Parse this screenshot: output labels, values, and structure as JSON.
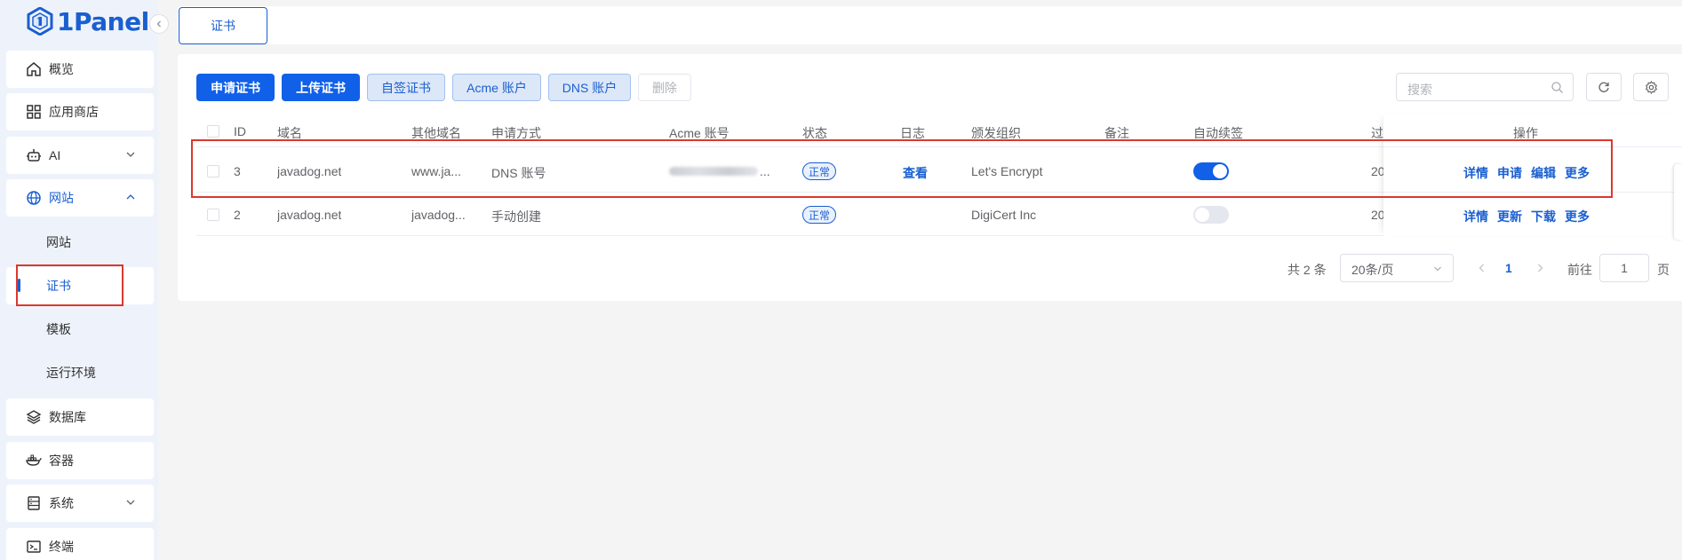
{
  "app": {
    "brand": "1Panel",
    "accent": "#1a5fd0",
    "highlight": "#d9392c"
  },
  "sidebar": {
    "items": [
      {
        "label": "概览",
        "icon": "home-icon"
      },
      {
        "label": "应用商店",
        "icon": "grid-icon"
      },
      {
        "label": "AI",
        "icon": "robot-icon"
      },
      {
        "label": "网站",
        "icon": "globe-icon"
      },
      {
        "label": "数据库",
        "icon": "layers-icon"
      },
      {
        "label": "容器",
        "icon": "docker-icon"
      },
      {
        "label": "系统",
        "icon": "server-icon"
      },
      {
        "label": "终端",
        "icon": "terminal-icon"
      }
    ],
    "website_subitems": [
      "网站",
      "证书",
      "模板",
      "运行环境"
    ],
    "active_subitem": "证书"
  },
  "header": {
    "tab": "证书"
  },
  "toolbar": {
    "apply_cert": "申请证书",
    "upload_cert": "上传证书",
    "self_signed": "自签证书",
    "acme_account": "Acme 账户",
    "dns_account": "DNS 账户",
    "delete": "删除",
    "search_placeholder": "搜索"
  },
  "table": {
    "columns": [
      "ID",
      "域名",
      "其他域名",
      "申请方式",
      "Acme 账号",
      "状态",
      "日志",
      "颁发组织",
      "备注",
      "自动续签",
      "过",
      "操作"
    ],
    "rows": [
      {
        "id": "3",
        "domain": "javadog.net",
        "other_domains": "www.ja...",
        "method": "DNS 账号",
        "acme_account": "(blurred)",
        "acme_suffix": "...",
        "status": "正常",
        "log": "查看",
        "issuer": "Let's Encrypt",
        "note": "",
        "auto_renew": true,
        "expire": "20",
        "actions": [
          "详情",
          "申请",
          "编辑",
          "更多"
        ]
      },
      {
        "id": "2",
        "domain": "javadog.net",
        "other_domains": "javadog...",
        "method": "手动创建",
        "acme_account": "",
        "status": "正常",
        "log": "",
        "issuer": "DigiCert Inc",
        "note": "",
        "auto_renew": false,
        "expire": "20",
        "actions": [
          "详情",
          "更新",
          "下载",
          "更多"
        ]
      }
    ]
  },
  "pagination": {
    "total": "共 2 条",
    "page_size": "20条/页",
    "current_page": "1",
    "goto_label": "前往",
    "goto_value": "1",
    "page_suffix": "页"
  }
}
